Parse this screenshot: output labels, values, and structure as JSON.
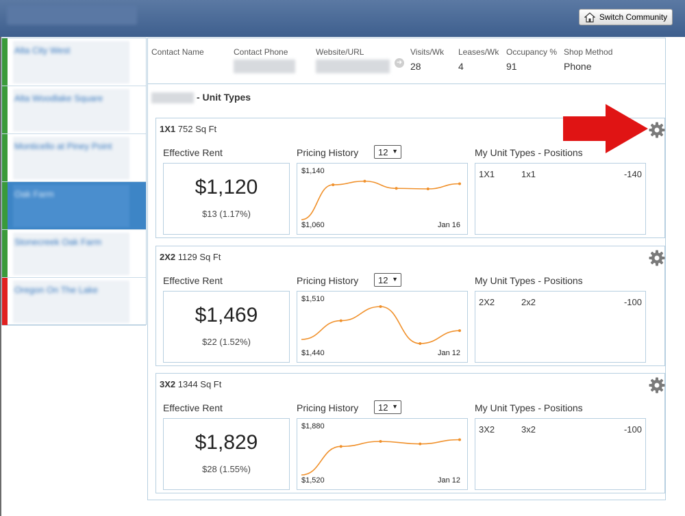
{
  "header": {
    "switch_label": "Switch Community"
  },
  "sidebar": {
    "items": [
      {
        "label": "Alta City West",
        "status_color": "#3a9a3a",
        "active": false
      },
      {
        "label": "Alta Woodlake Square",
        "status_color": "#3a9a3a",
        "active": false
      },
      {
        "label": "Monticello at Piney Point",
        "status_color": "#3a9a3a",
        "active": false
      },
      {
        "label": "Oak Farm",
        "status_color": "#3a9a3a",
        "active": true
      },
      {
        "label": "Stonecreek Oak Farm",
        "status_color": "#3a9a3a",
        "active": false
      },
      {
        "label": "Oregon On The Lake",
        "status_color": "#e02020",
        "active": false
      }
    ]
  },
  "community": {
    "contact_name_label": "Contact Name",
    "contact_phone_label": "Contact Phone",
    "website_label": "Website/URL",
    "visits_label": "Visits/Wk",
    "visits_value": "28",
    "leases_label": "Leases/Wk",
    "leases_value": "4",
    "occupancy_label": "Occupancy %",
    "occupancy_value": "91",
    "shop_label": "Shop Method",
    "shop_value": "Phone"
  },
  "unit_types_title": "- Unit Types",
  "labels": {
    "effective_rent": "Effective Rent",
    "pricing_history": "Pricing History",
    "positions": "My Unit Types - Positions"
  },
  "units": [
    {
      "code": "1X1",
      "size": "752 Sq Ft",
      "rent": "$1,120",
      "change": "$13 (1.17%)",
      "period": "12",
      "hi": "$1,140",
      "lo": "$1,060",
      "date": "Jan 16",
      "pos_code": "1X1",
      "pos_name": "1x1",
      "pos_value": "-140",
      "history": [
        1060,
        1128,
        1135,
        1121,
        1120,
        1130
      ]
    },
    {
      "code": "2X2",
      "size": "1129 Sq Ft",
      "rent": "$1,469",
      "change": "$22 (1.52%)",
      "period": "12",
      "hi": "$1,510",
      "lo": "$1,440",
      "date": "Jan 12",
      "pos_code": "2X2",
      "pos_name": "2x2",
      "pos_value": "-100",
      "history": [
        1454,
        1486,
        1510,
        1447,
        1469
      ]
    },
    {
      "code": "3X2",
      "size": "1344 Sq Ft",
      "rent": "$1,829",
      "change": "$28 (1.55%)",
      "period": "12",
      "hi": "$1,880",
      "lo": "$1,520",
      "date": "Jan 12",
      "pos_code": "3X2",
      "pos_name": "3x2",
      "pos_value": "-100",
      "history": [
        1520,
        1770,
        1814,
        1792,
        1829
      ]
    }
  ],
  "colors": {
    "accent": "#3d85c6",
    "line": "#f0902a",
    "border": "#b7cfe0",
    "annotation_arrow": "#e01414"
  }
}
